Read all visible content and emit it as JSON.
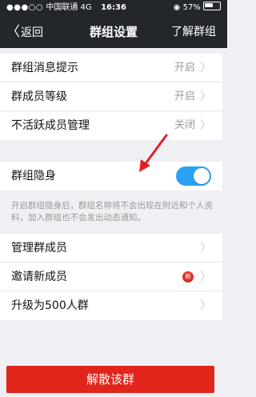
{
  "status_bar": {
    "signal": "●●●○○",
    "carrier": "中国联通",
    "network": "4G",
    "time": "16:36",
    "battery_percent": "57%"
  },
  "nav": {
    "back_label": "返回",
    "title": "群组设置",
    "right_label": "了解群组"
  },
  "group1": [
    {
      "label": "群组消息提示",
      "value": "开启"
    },
    {
      "label": "群成员等级",
      "value": "开启"
    },
    {
      "label": "不活跃成员管理",
      "value": "关闭"
    }
  ],
  "group2": {
    "label": "群组隐身",
    "toggle_on": true
  },
  "hint_text": "开启群组隐身后，群组名称将不会出现在附近和个人资料，加入群组也不会发出动态通知。",
  "group3": [
    {
      "label": "管理群成员"
    },
    {
      "label": "邀请新成员",
      "badge": "新"
    },
    {
      "label": "升级为500人群"
    }
  ],
  "dissolve_label": "解散该群",
  "colors": {
    "nav_bg": "#23262b",
    "toggle": "#2aa2f5",
    "danger": "#e1251b",
    "arrow": "#e0222a"
  }
}
